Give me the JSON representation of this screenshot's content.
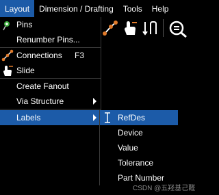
{
  "menubar": {
    "items": [
      {
        "label": "Layout"
      },
      {
        "label": "Dimension / Drafting"
      },
      {
        "label": "Tools"
      },
      {
        "label": "Help"
      }
    ]
  },
  "layout_menu": {
    "items": [
      {
        "label": "Pins",
        "icon": "pin-icon"
      },
      {
        "label": "Renumber Pins..."
      },
      {
        "label": "Connections",
        "shortcut": "F3",
        "icon": "connections-icon"
      },
      {
        "label": "Slide",
        "icon": "slide-icon"
      },
      {
        "label": "Create Fanout"
      },
      {
        "label": "Via Structure",
        "has_submenu": true
      },
      {
        "label": "Labels",
        "has_submenu": true,
        "highlighted": true
      }
    ]
  },
  "labels_submenu": {
    "items": [
      {
        "label": "RefDes",
        "highlighted": true,
        "icon": "text-cursor-icon"
      },
      {
        "label": "Device"
      },
      {
        "label": "Value"
      },
      {
        "label": "Tolerance"
      },
      {
        "label": "Part Number"
      }
    ]
  },
  "watermark": "CSDN @五羟基己醛",
  "colors": {
    "highlight": "#1c5ba8",
    "background": "#000000",
    "accent_orange": "#e07a2a"
  }
}
